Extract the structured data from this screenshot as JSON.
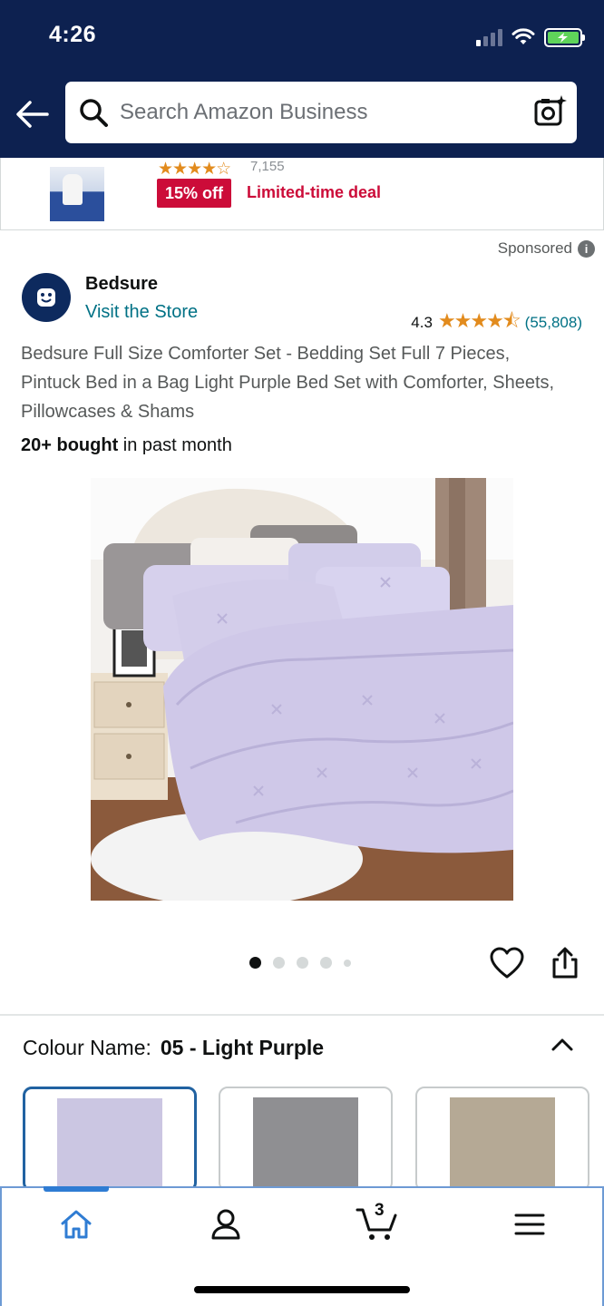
{
  "status_bar": {
    "time": "4:26"
  },
  "header": {
    "search_placeholder": "Search Amazon Business"
  },
  "deal": {
    "rating_count": "7,155",
    "badge": "15% off",
    "label": "Limited-time deal"
  },
  "sponsored_label": "Sponsored",
  "brand": {
    "name": "Bedsure",
    "store_link": "Visit the Store",
    "rating": "4.3",
    "rating_count": "(55,808)"
  },
  "product": {
    "title": "Bedsure Full Size Comforter Set - Bedding Set Full 7 Pieces, Pintuck Bed in a Bag Light Purple Bed Set with Comforter, Sheets, Pillowcases & Shams",
    "bought_bold": "20+ bought",
    "bought_rest": " in past month",
    "image_count": 5,
    "current_image": 1
  },
  "colour": {
    "label": "Colour Name:",
    "selected": "05 - Light Purple",
    "swatches": [
      {
        "name": "Light Purple",
        "color": "#cbc6e2"
      },
      {
        "name": "Grey",
        "color": "#8f8f92"
      },
      {
        "name": "Khaki",
        "color": "#b5a995"
      }
    ]
  },
  "bottom_nav": {
    "cart_count": "3",
    "accent_color": "#2f7cd3"
  },
  "colors": {
    "header": "#0d2150",
    "link": "#007185",
    "star": "#e28b1d",
    "deal_red": "#cc0c39"
  }
}
